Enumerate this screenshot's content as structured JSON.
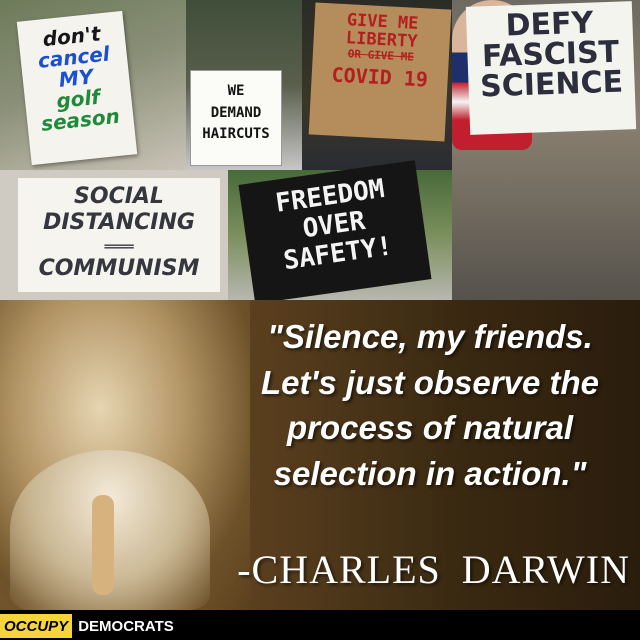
{
  "collage": {
    "sign_golf": [
      "don't",
      "cancel MY",
      "golf season"
    ],
    "sign_haircuts": [
      "WE",
      "DEMAND",
      "HAIRCUTS"
    ],
    "sign_liberty": {
      "line1": "GIVE ME",
      "line2": "LIBERTY",
      "crossed": "OR GIVE ME",
      "line3": "COVID 19"
    },
    "sign_defy": [
      "DEFY",
      "FASCIST",
      "SCIENCE"
    ],
    "sign_social": {
      "line1": "SOCIAL",
      "line2": "DISTANCING",
      "equals": "═══",
      "line3": "COMMUNISM"
    },
    "sign_freedom": [
      "FREEDOM",
      "OVER",
      "SAFETY!"
    ]
  },
  "quote": {
    "text": "\"Silence, my friends.\nLet's just observe the\nprocess of natural\nselection in action.\"",
    "attribution": "-CHARLES  DARWIN"
  },
  "footer": {
    "brand_part1": "OCCUPY",
    "brand_part2": "DEMOCRATS",
    "brand_part1_bg": "#f6d43b"
  }
}
